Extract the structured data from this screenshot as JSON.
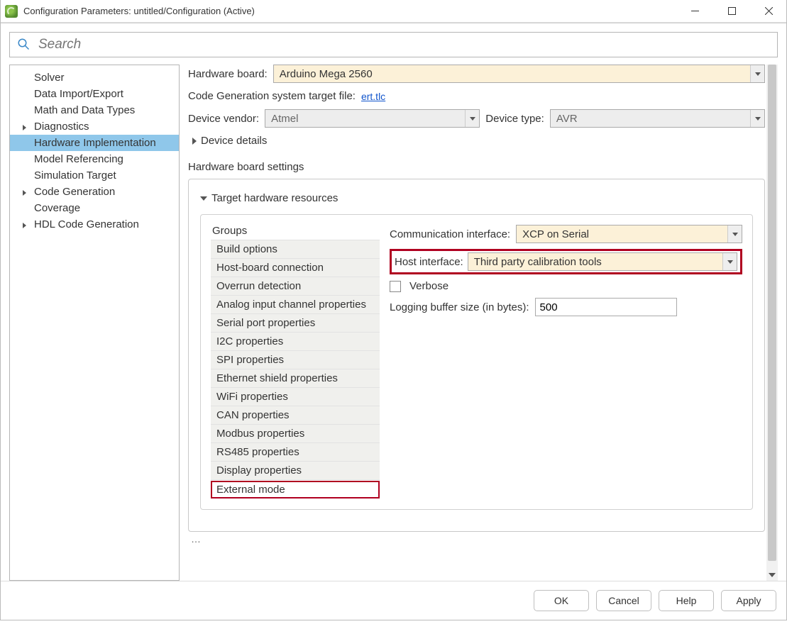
{
  "title": "Configuration Parameters: untitled/Configuration (Active)",
  "search": {
    "placeholder": "Search"
  },
  "tree": {
    "items": [
      {
        "label": "Solver",
        "arrow": false
      },
      {
        "label": "Data Import/Export",
        "arrow": false
      },
      {
        "label": "Math and Data Types",
        "arrow": false
      },
      {
        "label": "Diagnostics",
        "arrow": true
      },
      {
        "label": "Hardware Implementation",
        "arrow": false,
        "selected": true
      },
      {
        "label": "Model Referencing",
        "arrow": false
      },
      {
        "label": "Simulation Target",
        "arrow": false
      },
      {
        "label": "Code Generation",
        "arrow": true
      },
      {
        "label": "Coverage",
        "arrow": false
      },
      {
        "label": "HDL Code Generation",
        "arrow": true
      }
    ]
  },
  "form": {
    "hardware_board_label": "Hardware board:",
    "hardware_board_value": "Arduino Mega 2560",
    "codegen_label": "Code Generation system target file:",
    "codegen_link": "ert.tlc",
    "device_vendor_label": "Device vendor:",
    "device_vendor_value": "Atmel",
    "device_type_label": "Device type:",
    "device_type_value": "AVR",
    "device_details_label": "Device details",
    "hardware_settings_label": "Hardware board settings",
    "target_resources_label": "Target hardware resources"
  },
  "groups": {
    "header": "Groups",
    "items": [
      "Build options",
      "Host-board connection",
      "Overrun detection",
      "Analog input channel properties",
      "Serial port properties",
      "I2C properties",
      "SPI properties",
      "Ethernet shield properties",
      "WiFi properties",
      "CAN properties",
      "Modbus properties",
      "RS485 properties",
      "Display properties",
      "External mode"
    ],
    "selected_index": 13
  },
  "props": {
    "comm_label": "Communication interface:",
    "comm_value": "XCP on Serial",
    "host_label": "Host interface:",
    "host_value": "Third party calibration tools",
    "verbose_label": "Verbose",
    "verbose_checked": false,
    "logbuf_label": "Logging buffer size (in bytes):",
    "logbuf_value": "500"
  },
  "footer": {
    "ok": "OK",
    "cancel": "Cancel",
    "help": "Help",
    "apply": "Apply"
  }
}
